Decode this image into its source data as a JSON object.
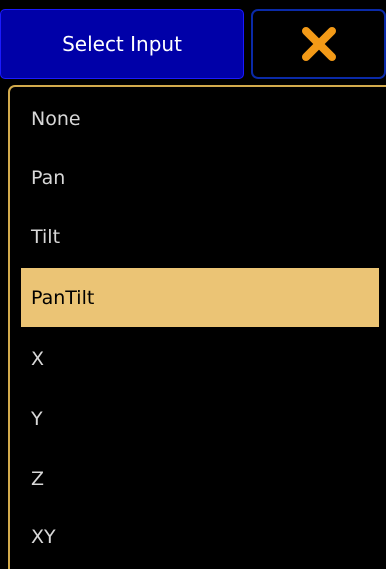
{
  "header": {
    "title": "Select Input",
    "close_icon": "close-x-icon",
    "close_icon_color": "#f39a17"
  },
  "colors": {
    "title_background": "#0000a8",
    "panel_border": "#d2aa4c",
    "selection_background": "#ebc475",
    "item_text": "#d8d8d8"
  },
  "list": {
    "selected": "PanTilt",
    "items": [
      {
        "label": "None"
      },
      {
        "label": "Pan"
      },
      {
        "label": "Tilt"
      },
      {
        "label": "PanTilt"
      },
      {
        "label": "X"
      },
      {
        "label": "Y"
      },
      {
        "label": "Z"
      },
      {
        "label": "XY"
      }
    ]
  }
}
